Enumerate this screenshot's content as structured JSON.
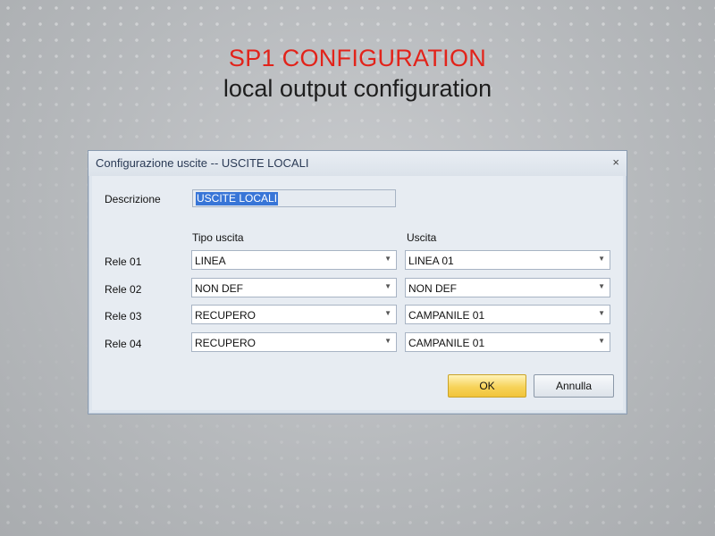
{
  "heading": {
    "title": "SP1 CONFIGURATION",
    "subtitle": "local output configuration",
    "title_color": "#e2231a"
  },
  "dialog": {
    "title": "Configurazione uscite -- USCITE LOCALI",
    "close_glyph": "×",
    "description_label": "Descrizione",
    "description_value": "USCITE LOCALI",
    "column_type": "Tipo uscita",
    "column_output": "Uscita",
    "rows": [
      {
        "label": "Rele  01",
        "type": "LINEA",
        "output": "LINEA 01"
      },
      {
        "label": "Rele  02",
        "type": "NON DEF",
        "output": "NON DEF"
      },
      {
        "label": "Rele  03",
        "type": "RECUPERO",
        "output": "CAMPANILE 01"
      },
      {
        "label": "Rele  04",
        "type": "RECUPERO",
        "output": "CAMPANILE 01"
      }
    ],
    "dropdown_icon": "chevron-down-icon",
    "ok_label": "OK",
    "cancel_label": "Annulla",
    "ok_color": "#f7d35a"
  }
}
